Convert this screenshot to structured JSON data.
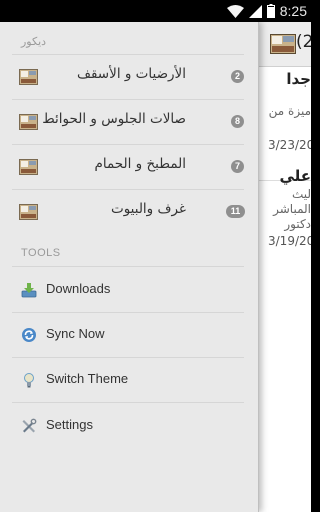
{
  "status_bar": {
    "time": "8:25",
    "icons": [
      "wifi-icon",
      "signal-icon",
      "battery-icon",
      "notification-icon"
    ]
  },
  "drawer": {
    "section_categories": "ديكور",
    "categories": [
      {
        "label": "الأرضيات و الأسقف",
        "count": "2"
      },
      {
        "label": "صالات الجلوس و الحوائط",
        "count": "8"
      },
      {
        "label": "المطبخ و الحمام",
        "count": "7"
      },
      {
        "label": "غرف والبيوت",
        "count": "11"
      }
    ],
    "section_tools": "TOOLS",
    "tools": [
      {
        "label": "Downloads",
        "icon": "download-icon"
      },
      {
        "label": "Sync Now",
        "icon": "sync-icon"
      },
      {
        "label": "Switch Theme",
        "icon": "lightbulb-icon"
      },
      {
        "label": "Settings",
        "icon": "settings-tools-icon"
      }
    ]
  },
  "main": {
    "header_title": "(2",
    "articles": [
      {
        "title": "جدا",
        "snippet": "ميزة من",
        "date": "3/23/20"
      },
      {
        "title": "علي",
        "snippet_lines": [
          "ليث",
          "المباشر",
          "دكتور"
        ],
        "date": "3/19/20"
      }
    ]
  },
  "colors": {
    "drawer_bg": "#e9e9e9",
    "badge_bg": "#8f8f8f",
    "section_text": "#9a9a9a",
    "text": "#333333"
  }
}
